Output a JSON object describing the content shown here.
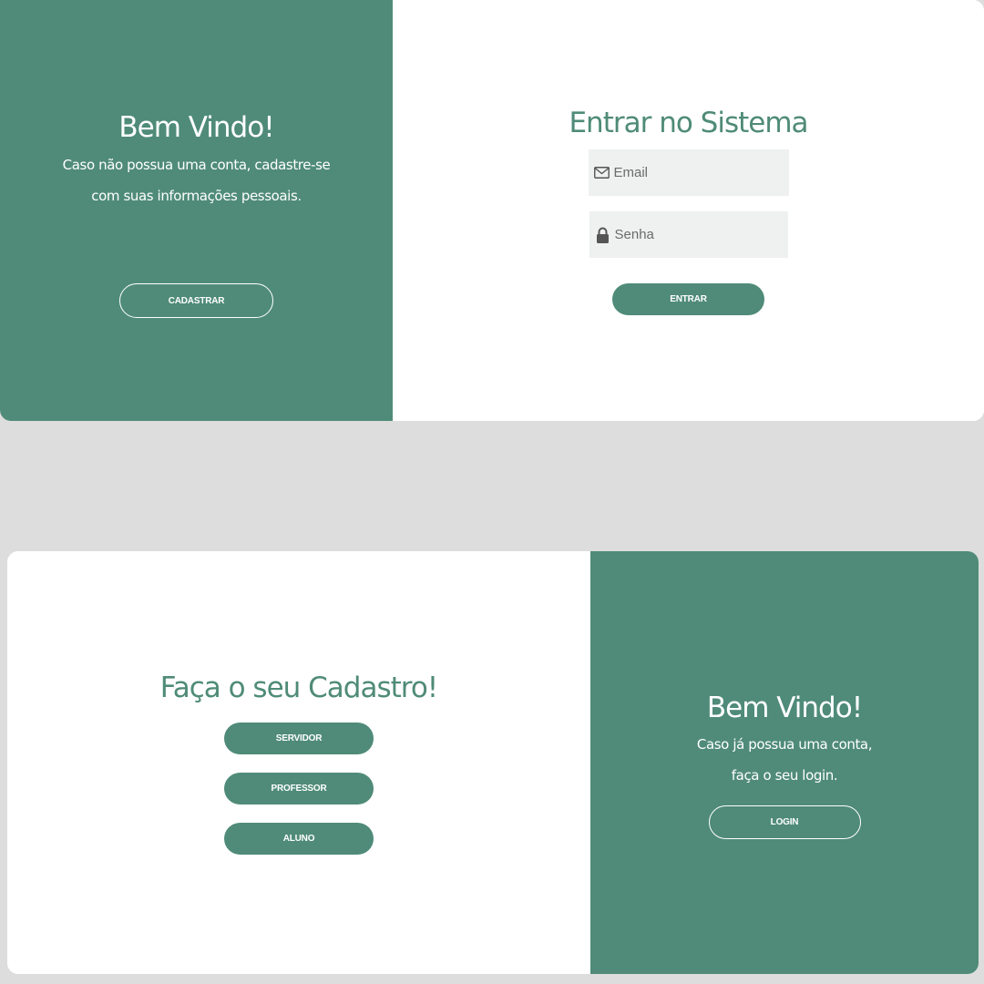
{
  "login_screen": {
    "welcome": {
      "title": "Bem Vindo!",
      "text_line1": "Caso não possua uma conta, cadastre-se",
      "text_line2": "com suas informações pessoais.",
      "button_label": "CADASTRAR"
    },
    "form": {
      "title": "Entrar no Sistema",
      "email_placeholder": "Email",
      "email_icon": "envelope-icon",
      "password_placeholder": "Senha",
      "password_icon": "lock-icon",
      "submit_label": "ENTRAR"
    }
  },
  "signup_screen": {
    "form": {
      "title": "Faça o seu Cadastro!",
      "buttons": [
        "SERVIDOR",
        "PROFESSOR",
        "ALUNO"
      ]
    },
    "welcome": {
      "title": "Bem Vindo!",
      "text_line1": "Caso já possua uma conta,",
      "text_line2": "faça o seu login.",
      "button_label": "LOGIN"
    }
  },
  "colors": {
    "accent": "#4f8b78",
    "background": "#dcdddc",
    "input_bg": "#eef1f0"
  }
}
